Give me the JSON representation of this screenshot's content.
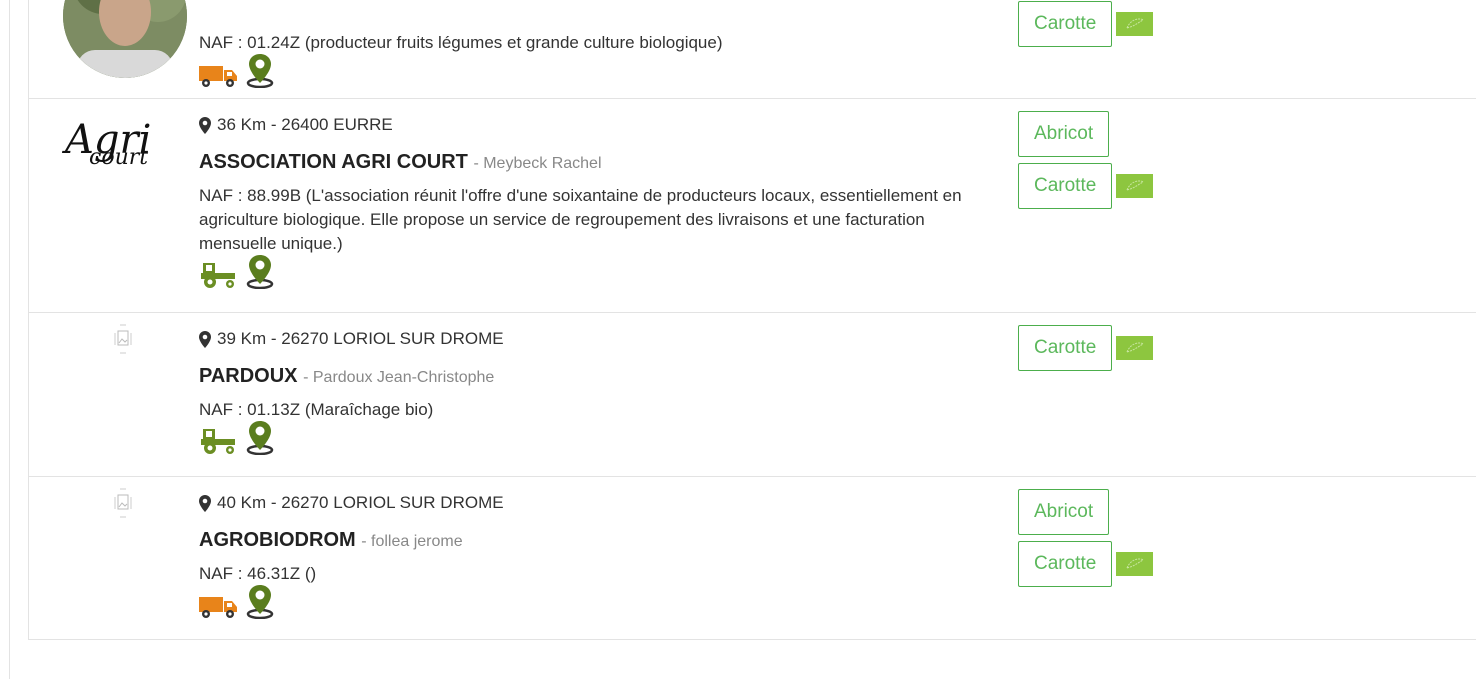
{
  "colors": {
    "accent_green": "#5cb85c",
    "bio_green": "#8dc63f",
    "truck_orange": "#e8841a",
    "tractor_green": "#6b8e23",
    "pin_green": "#5a7d1e"
  },
  "listings": [
    {
      "location": "",
      "name": "",
      "owner": "",
      "naf": "NAF : 01.24Z (producteur fruits légumes et grande culture biologique)",
      "vehicle_icon": "truck-icon",
      "products": [
        {
          "label": "Carotte",
          "bio": true
        }
      ]
    },
    {
      "location": "36 Km  -  26400 EURRE",
      "name": "ASSOCIATION AGRI COURT",
      "owner": "- Meybeck Rachel",
      "naf": "NAF : 88.99B (L'association réunit l'offre d'une soixantaine de producteurs locaux, essentiellement en agriculture biologique. Elle propose un service de regroupement des livraisons et une facturation mensuelle unique.)",
      "logo_text_1": "Agri",
      "logo_text_2": "court",
      "vehicle_icon": "tractor-icon",
      "products": [
        {
          "label": "Abricot",
          "bio": false
        },
        {
          "label": "Carotte",
          "bio": true
        }
      ]
    },
    {
      "location": "39 Km  -  26270 LORIOL SUR DROME",
      "name": "PARDOUX",
      "owner": "- Pardoux  Jean-Christophe",
      "naf": "NAF : 01.13Z (Maraîchage bio)",
      "vehicle_icon": "tractor-icon",
      "products": [
        {
          "label": "Carotte",
          "bio": true
        }
      ]
    },
    {
      "location": "40 Km  -  26270 LORIOL SUR DROME",
      "name": "AGROBIODROM",
      "owner": "- follea jerome",
      "naf": "NAF : 46.31Z ()",
      "vehicle_icon": "truck-icon",
      "products": [
        {
          "label": "Abricot",
          "bio": false
        },
        {
          "label": "Carotte",
          "bio": true
        }
      ]
    }
  ]
}
